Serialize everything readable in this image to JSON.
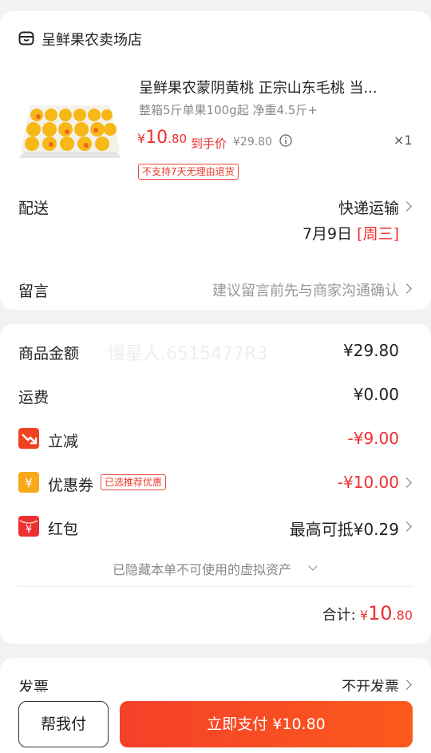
{
  "shop": {
    "name": "呈鲜果农卖场店",
    "icon": "shop-icon"
  },
  "product": {
    "title": "呈鲜果农蒙阴黄桃 正宗山东毛桃 当...",
    "spec": "整箱5斤单果100g起 净重4.5斤+",
    "price_symbol": "¥",
    "price_int": "10",
    "price_dec": ".80",
    "final_price_label": "到手价",
    "original_price": "¥29.80",
    "quantity": "×1",
    "no_return_tag": "不支持7天无理由退货",
    "image": "yellow-peach-box-image"
  },
  "delivery": {
    "label": "配送",
    "method": "快递运输",
    "date": "7月9日",
    "weekday": "[周三]"
  },
  "note": {
    "label": "留言",
    "placeholder": "建议留言前先与商家沟通确认"
  },
  "summary": {
    "watermark": "慢星人.6515477R3",
    "goods_amount": {
      "label": "商品金额",
      "value": "¥29.80"
    },
    "shipping": {
      "label": "运费",
      "value": "¥0.00"
    },
    "discount": {
      "label": "立减",
      "value": "-¥9.00",
      "icon": "discount-arrow-icon"
    },
    "coupon": {
      "label": "优惠券",
      "tag": "已选推荐优惠",
      "value": "-¥10.00",
      "icon": "coupon-icon"
    },
    "red_packet": {
      "label": "红包",
      "value": "最高可抵¥0.29",
      "icon": "red-packet-icon"
    },
    "hidden_note": "已隐藏本单不可使用的虚拟资产",
    "total_label": "合计:",
    "total_symbol": "¥",
    "total_int": "10",
    "total_dec": ".80"
  },
  "invoice": {
    "label": "发票",
    "value": "不开发票"
  },
  "footer": {
    "help_pay": "帮我付",
    "pay_now": "立即支付 ¥10.80"
  },
  "colors": {
    "accent": "#ee2f2f",
    "pay_gradient_start": "#f5402a",
    "pay_gradient_end": "#fb5a1c"
  }
}
